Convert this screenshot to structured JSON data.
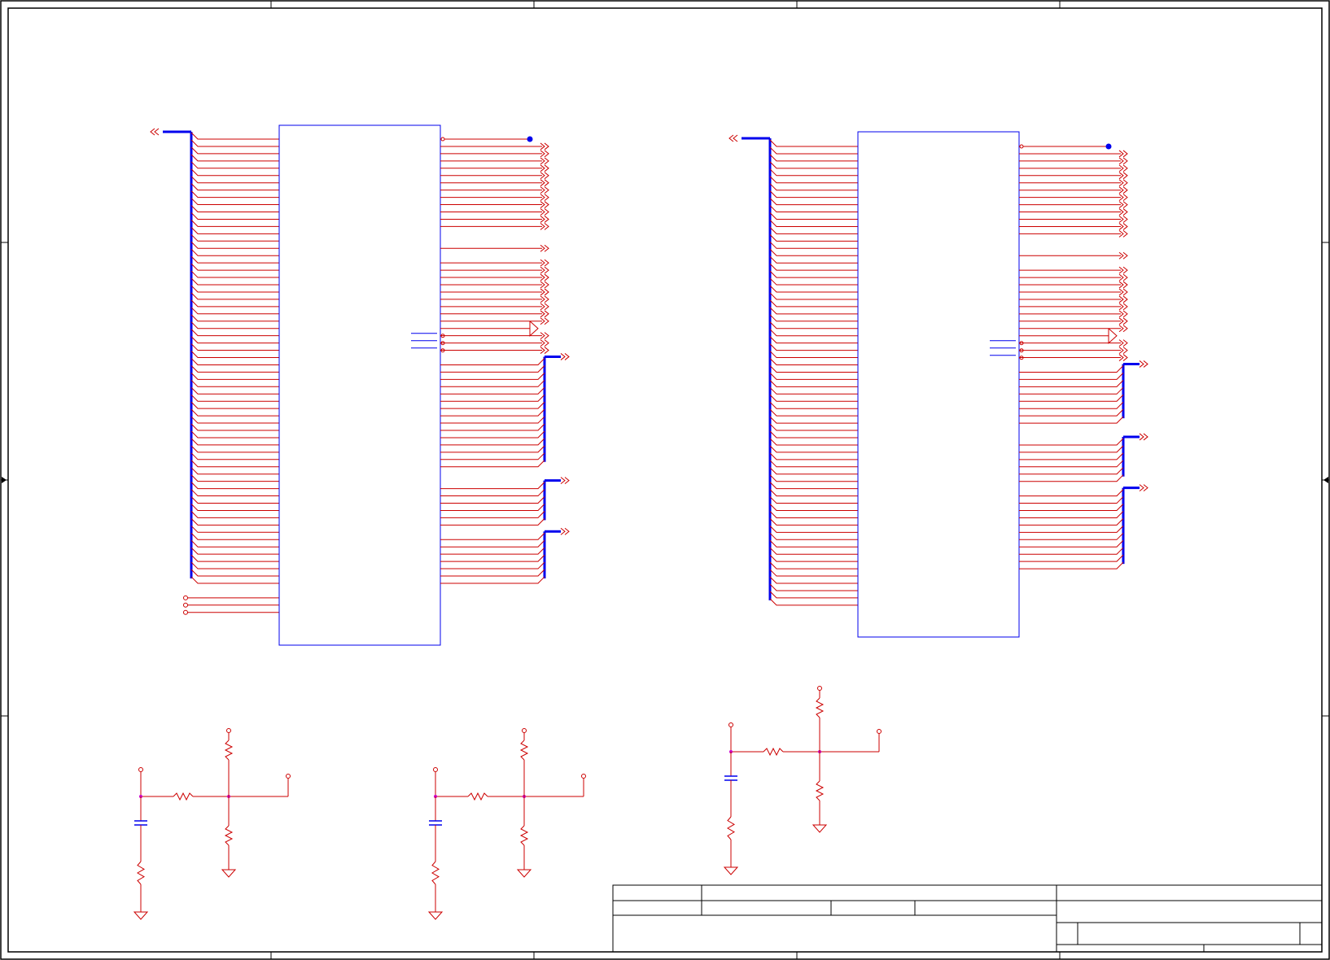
{
  "sheet": {
    "background": "#ffffff",
    "border_color": "#000000",
    "wire_color": "#cc0000",
    "bus_color": "#0000ee",
    "junction_color": "#cc00cc",
    "junction_dot_color": "#0000ee",
    "symbol_outline_color": "#0000ee"
  },
  "connectors": {
    "left": {
      "input_wires": 62,
      "tail_pins": 3,
      "output_group_a": 13,
      "output_group_b": 11,
      "output_group_c": 3
    },
    "right": {
      "input_wires": 64,
      "tail_pins": 0,
      "output_group_a": 13,
      "output_group_b": 4,
      "output_group_c": 7
    }
  },
  "title_block": {
    "title": "",
    "size": "",
    "document_number": "",
    "revision": "",
    "date": "",
    "sheet": ""
  }
}
